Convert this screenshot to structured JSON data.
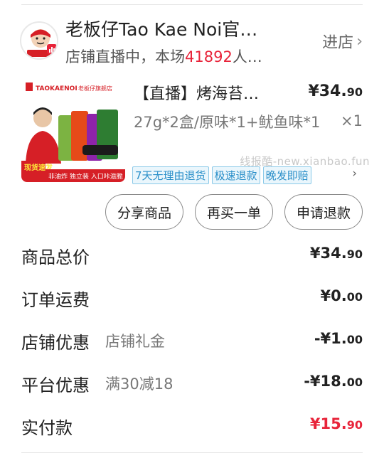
{
  "shop": {
    "name": "老板仔Tao Kae Noi官…",
    "live_prefix": "店铺直播中，本场",
    "live_count": "41892",
    "live_suffix": "人…",
    "enter_label": "进店",
    "logo_text": "TAO KAE NOI"
  },
  "product": {
    "title": "【直播】烤海苔…",
    "price_currency": "¥",
    "price_int": "34.",
    "price_dec": "90",
    "spec": "27g*2盒/原味*1+鱿鱼味*1",
    "qty": "×1",
    "tags": [
      "7天无理由退货",
      "极速退款",
      "晚发即赔"
    ],
    "thumb_brand": "TAOKAENOI",
    "thumb_brand_cn": "老板仔旗舰店",
    "thumb_badge": "现货速发",
    "thumb_footer": "非油炸 独立装 入口咔滋脆"
  },
  "watermark": "线报酷-new.xianbao.fun",
  "actions": {
    "share": "分享商品",
    "rebuy": "再买一单",
    "refund": "申请退款"
  },
  "summary": {
    "total_label": "商品总价",
    "total_int": "¥34.",
    "total_dec": "90",
    "shipping_label": "订单运费",
    "shipping_int": "¥0.",
    "shipping_dec": "00",
    "store_disc_label": "店铺优惠",
    "store_disc_sub": "店铺礼金",
    "store_disc_int": "-¥1.",
    "store_disc_dec": "00",
    "platform_disc_label": "平台优惠",
    "platform_disc_sub": "满30减18",
    "platform_disc_int": "-¥18.",
    "platform_disc_dec": "00",
    "paid_label": "实付款",
    "paid_int": "¥15.",
    "paid_dec": "90"
  },
  "colors": {
    "accent_red": "#e8243a",
    "tag_blue": "#2a8fc9"
  }
}
